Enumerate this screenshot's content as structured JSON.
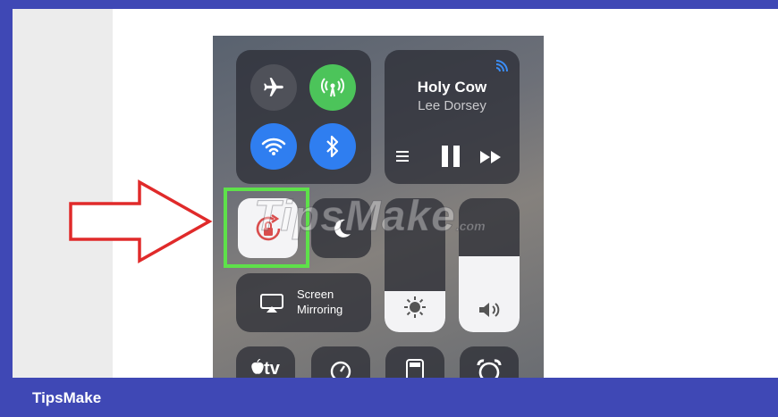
{
  "brand": "TipsMake",
  "watermark": {
    "text": "TipsMake",
    "suffix": ".com"
  },
  "music": {
    "title": "Holy Cow",
    "artist": "Lee Dorsey"
  },
  "screen_mirroring": {
    "line1": "Screen",
    "line2": "Mirroring"
  },
  "apple_tv_label": "tv",
  "levels": {
    "brightness": 0.31,
    "volume": 0.57
  },
  "icons": [
    "airplane-icon",
    "cellular-icon",
    "wifi-icon",
    "bluetooth-icon",
    "airplay-icon",
    "list-icon",
    "pause-icon",
    "next-icon",
    "rotation-lock-icon",
    "moon-icon",
    "sun-icon",
    "speaker-icon",
    "screen-mirroring-icon",
    "apple-tv-icon",
    "timer-icon",
    "calculator-icon",
    "alarm-icon",
    "arrow-icon"
  ],
  "colors": {
    "frame": "#3f48b5",
    "highlight": "#5ee14a",
    "arrow": "#e02a2a",
    "cellular": "#4cc45a",
    "wifi": "#2f7ef0"
  }
}
